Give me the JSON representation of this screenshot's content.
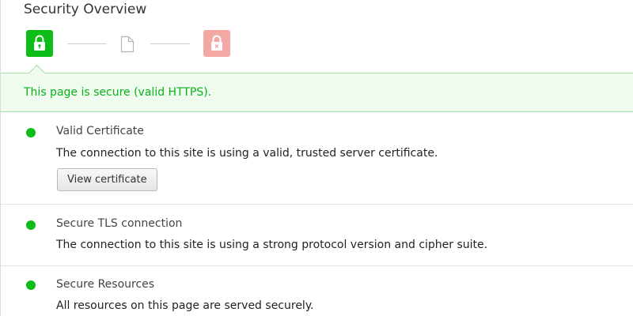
{
  "header": {
    "title": "Security Overview"
  },
  "steps": [
    {
      "state": "secure",
      "icon": "lock-icon",
      "color": "#0bbd16"
    },
    {
      "state": "neutral",
      "icon": "document-icon",
      "color": "#cfcfcf"
    },
    {
      "state": "insecure",
      "icon": "broken-lock-icon",
      "color": "#f3a8a4"
    }
  ],
  "summary": {
    "text": "This page is secure (valid HTTPS).",
    "color": "#0bb21a"
  },
  "sections": [
    {
      "title": "Valid Certificate",
      "description": "The connection to this site is using a valid, trusted server certificate.",
      "button_label": "View certificate",
      "status_color": "#0bbd16"
    },
    {
      "title": "Secure TLS connection",
      "description": "The connection to this site is using a strong protocol version and cipher suite.",
      "status_color": "#0bbd16"
    },
    {
      "title": "Secure Resources",
      "description": "All resources on this page are served securely.",
      "status_color": "#0bbd16"
    }
  ]
}
